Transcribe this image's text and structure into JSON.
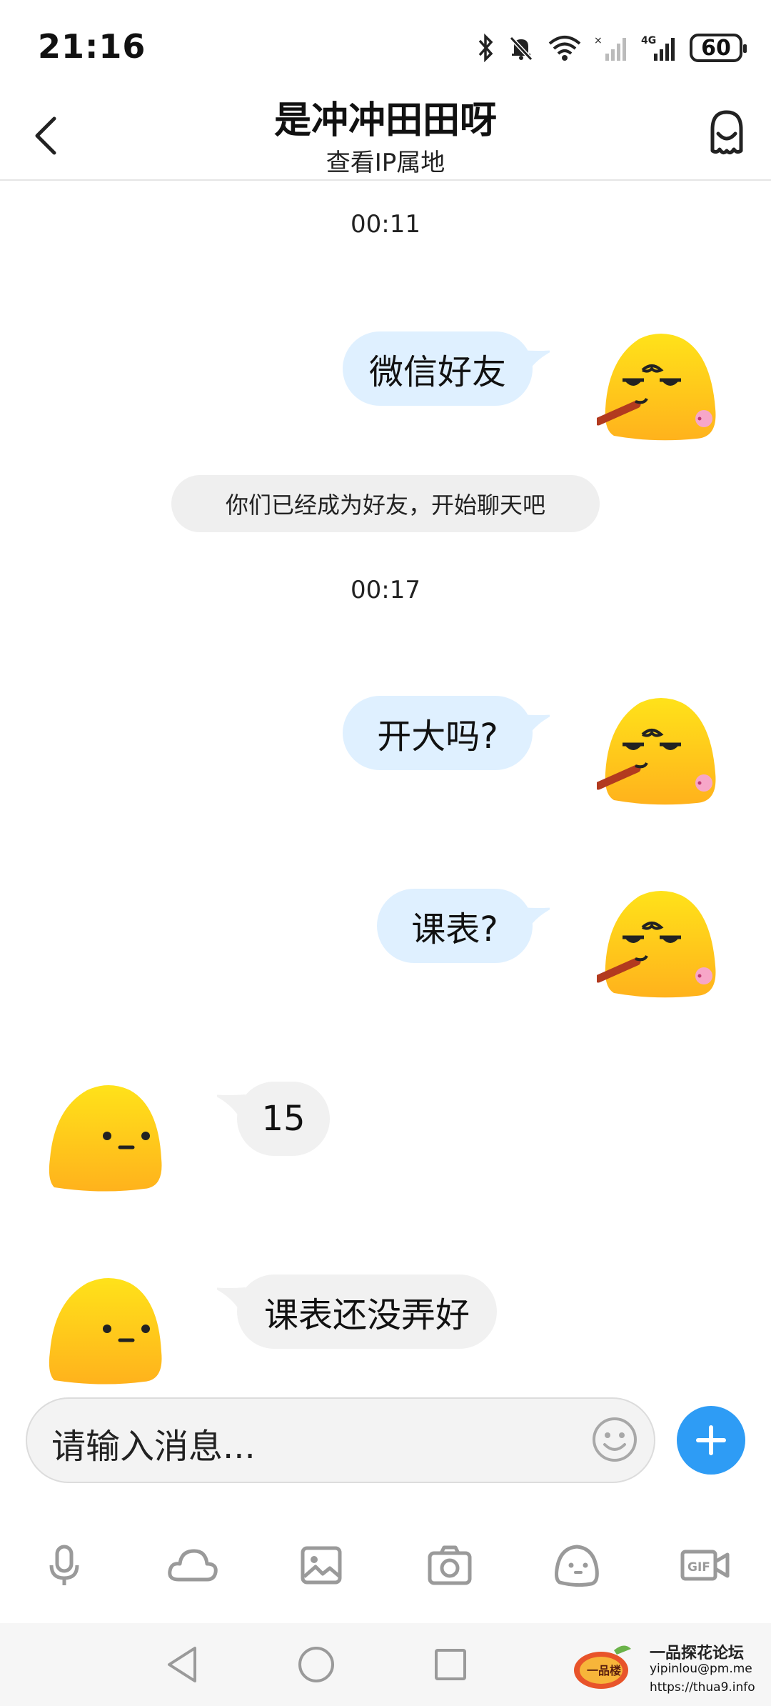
{
  "status_bar": {
    "time": "21:16",
    "battery": "60"
  },
  "header": {
    "title": "是冲冲田田呀",
    "subtitle": "查看IP属地"
  },
  "messages": {
    "time1": "00:11",
    "out1": "微信好友",
    "system": "你们已经成为好友，开始聊天吧",
    "time2": "00:17",
    "out2": "开大吗?",
    "out3": "课表?",
    "in1": "15",
    "in2": "课表还没弄好"
  },
  "input": {
    "placeholder": "请输入消息..."
  },
  "toolbar": [
    "mic-icon",
    "cloud-icon",
    "image-icon",
    "camera-icon",
    "sticker-icon",
    "gif-icon"
  ],
  "watermark": {
    "logo_text": "一品楼",
    "title": "一品探花论坛",
    "email": "yipinlou@pm.me",
    "url": "https://thua9.info"
  },
  "colors": {
    "accent": "#2e9cf5",
    "out_bubble": "#dff0ff",
    "in_bubble": "#f1f1f1",
    "avatar_yellow": "#ffc21a"
  }
}
